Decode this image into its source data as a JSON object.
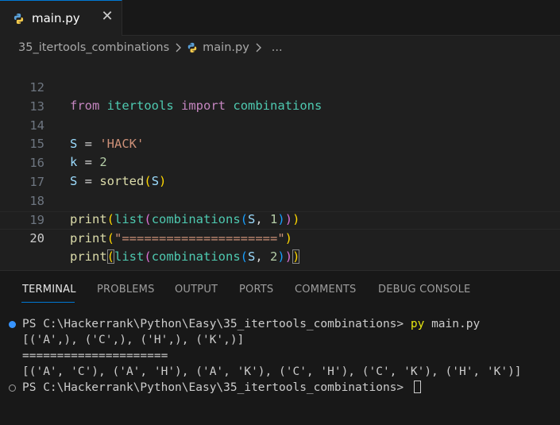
{
  "tab": {
    "label": "main.py",
    "close_glyph": "✕",
    "icon": "python-icon"
  },
  "breadcrumb": {
    "folder": "35_itertools_combinations",
    "file": "main.py",
    "more": "..."
  },
  "editor": {
    "lines": [
      {
        "number": "12"
      },
      {
        "number": "13"
      },
      {
        "number": "14"
      },
      {
        "number": "15"
      },
      {
        "number": "16"
      },
      {
        "number": "17"
      },
      {
        "number": "18"
      },
      {
        "number": "19"
      },
      {
        "number": "20"
      }
    ],
    "tokens": {
      "from": "from",
      "itertools": "itertools",
      "import": "import",
      "combinations": "combinations",
      "S": "S",
      "k": "k",
      "eq": " = ",
      "hack": "'HACK'",
      "two": "2",
      "one": "1",
      "sorted": "sorted",
      "print": "print",
      "list": "list",
      "lparen": "(",
      "rparen": ")",
      "comma": ", ",
      "equals_str": "\"=====================\""
    }
  },
  "panel": {
    "tabs": [
      "TERMINAL",
      "PROBLEMS",
      "OUTPUT",
      "PORTS",
      "COMMENTS",
      "DEBUG CONSOLE"
    ],
    "active_tab": "TERMINAL"
  },
  "terminal": {
    "prompt": "PS C:\\Hackerrank\\Python\\Easy\\35_itertools_combinations> ",
    "command_py": "py",
    "command_rest": " main.py",
    "output_1": "[('A',), ('C',), ('H',), ('K',)]",
    "output_2": "=====================",
    "output_3": "[('A', 'C'), ('A', 'H'), ('A', 'K'), ('C', 'H'), ('C', 'K'), ('H', 'K')]",
    "prompt_2": "PS C:\\Hackerrank\\Python\\Easy\\35_itertools_combinations> "
  },
  "colors": {
    "accent": "#0078d4",
    "success_dot": "#3794ff"
  }
}
